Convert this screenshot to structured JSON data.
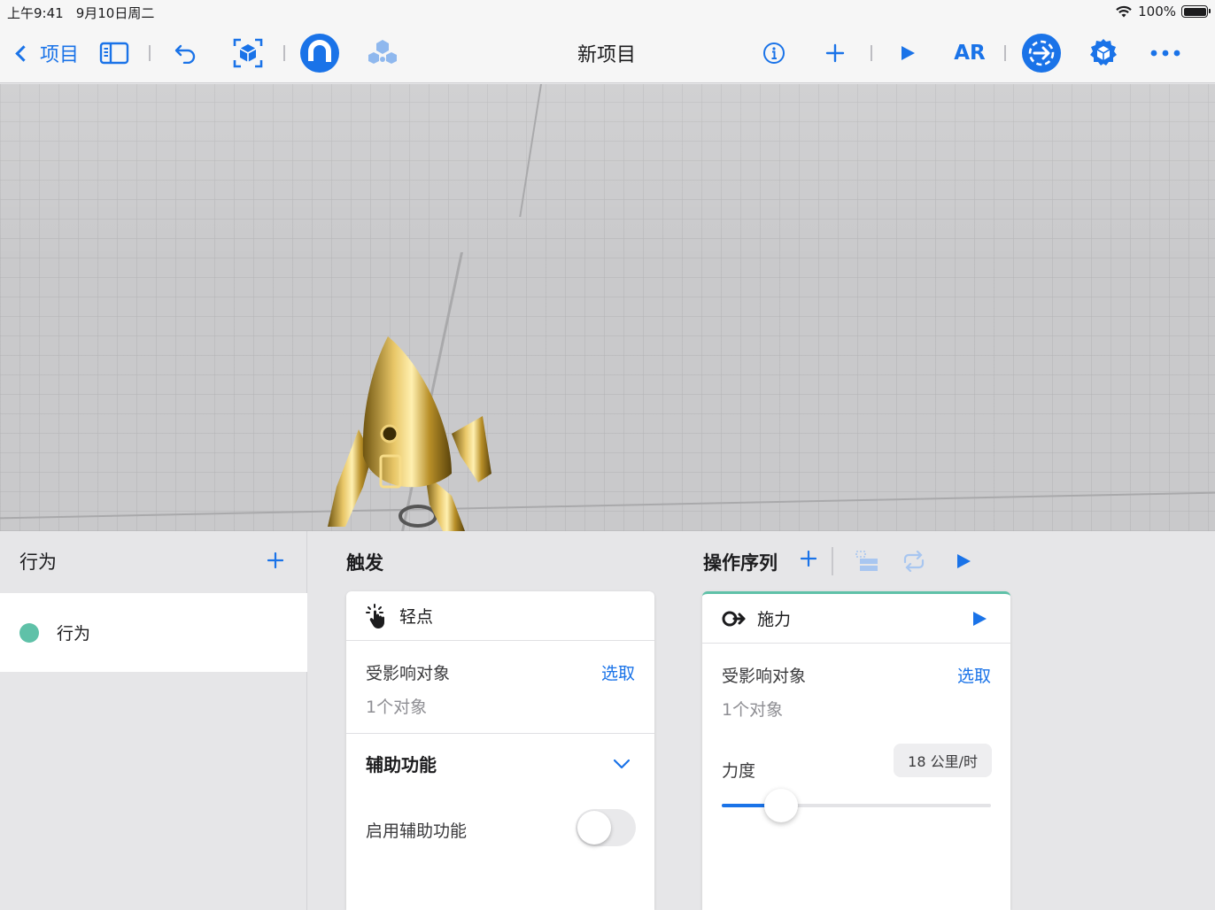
{
  "status": {
    "time": "上午9:41",
    "date": "9月10日周二",
    "battery": "100%"
  },
  "toolbar": {
    "back_label": "项目",
    "title": "新项目",
    "ar_label": "AR"
  },
  "behaviors": {
    "header": "行为",
    "items": [
      {
        "label": "行为",
        "color": "#5fc1a8"
      }
    ]
  },
  "trigger": {
    "section_title": "触发",
    "card_title": "轻点",
    "affected_label": "受影响对象",
    "select_label": "选取",
    "count": "1个对象",
    "accessibility_title": "辅助功能",
    "enable_label": "启用辅助功能",
    "enable_value": false
  },
  "actions": {
    "section_title": "操作序列",
    "card_title": "施力",
    "affected_label": "受影响对象",
    "select_label": "选取",
    "count": "1个对象",
    "force_label": "力度",
    "force_value": "18 公里/时",
    "force_fraction": 0.22
  },
  "colors": {
    "accent": "#1a73e8",
    "teal": "#5fc1a8"
  }
}
